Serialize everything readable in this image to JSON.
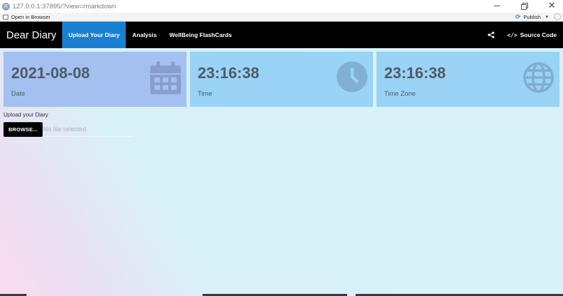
{
  "window": {
    "url": "127.0.0.1:37895/?view=rmarkdown",
    "app_icon": "R"
  },
  "viewer_toolbar": {
    "open_in_browser": "Open in Browser",
    "publish": "Publish"
  },
  "navbar": {
    "brand": "Dear Diary",
    "tabs": [
      {
        "label": "Upload Your Diary",
        "active": true
      },
      {
        "label": "Analysis",
        "active": false
      },
      {
        "label": "WellBeing FlashCards",
        "active": false
      }
    ],
    "source_code": "Source Code"
  },
  "value_boxes": [
    {
      "value": "2021-08-08",
      "caption": "Date",
      "icon": "calendar-icon"
    },
    {
      "value": "23:16:38",
      "caption": "Time",
      "icon": "clock-icon"
    },
    {
      "value": "23:16:38",
      "caption": "Time Zone",
      "icon": "globe-icon"
    }
  ],
  "upload": {
    "label": "Upload your Diary",
    "button": "BROWSE...",
    "placeholder": "No file selected"
  },
  "colors": {
    "navbar_bg": "#000000",
    "active_tab": "#1a7fd0",
    "date_box": "#a3c0f0",
    "time_box": "#99d3f6"
  }
}
